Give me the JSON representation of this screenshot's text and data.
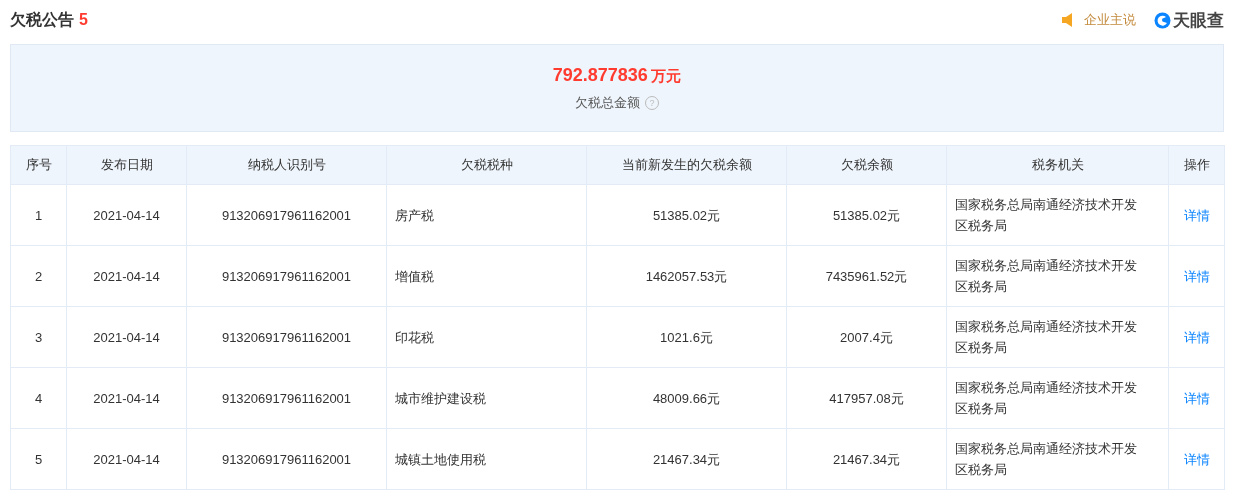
{
  "header": {
    "title": "欠税公告",
    "count": "5",
    "statement_link": "企业主说",
    "brand": "天眼查"
  },
  "summary": {
    "amount": "792.877836",
    "unit": "万元",
    "label": "欠税总金额",
    "help": "?"
  },
  "table": {
    "columns": [
      "序号",
      "发布日期",
      "纳税人识别号",
      "欠税税种",
      "当前新发生的欠税余额",
      "欠税余额",
      "税务机关",
      "操作"
    ],
    "rows": [
      {
        "index": "1",
        "date": "2021-04-14",
        "taxpayer_id": "913206917961162001",
        "tax_type": "房产税",
        "new_balance": "51385.02元",
        "balance": "51385.02元",
        "authority": "国家税务总局南通经济技术开发区税务局",
        "action": "详情"
      },
      {
        "index": "2",
        "date": "2021-04-14",
        "taxpayer_id": "913206917961162001",
        "tax_type": "增值税",
        "new_balance": "1462057.53元",
        "balance": "7435961.52元",
        "authority": "国家税务总局南通经济技术开发区税务局",
        "action": "详情"
      },
      {
        "index": "3",
        "date": "2021-04-14",
        "taxpayer_id": "913206917961162001",
        "tax_type": "印花税",
        "new_balance": "1021.6元",
        "balance": "2007.4元",
        "authority": "国家税务总局南通经济技术开发区税务局",
        "action": "详情"
      },
      {
        "index": "4",
        "date": "2021-04-14",
        "taxpayer_id": "913206917961162001",
        "tax_type": "城市维护建设税",
        "new_balance": "48009.66元",
        "balance": "417957.08元",
        "authority": "国家税务总局南通经济技术开发区税务局",
        "action": "详情"
      },
      {
        "index": "5",
        "date": "2021-04-14",
        "taxpayer_id": "913206917961162001",
        "tax_type": "城镇土地使用税",
        "new_balance": "21467.34元",
        "balance": "21467.34元",
        "authority": "国家税务总局南通经济技术开发区税务局",
        "action": "详情"
      }
    ]
  }
}
